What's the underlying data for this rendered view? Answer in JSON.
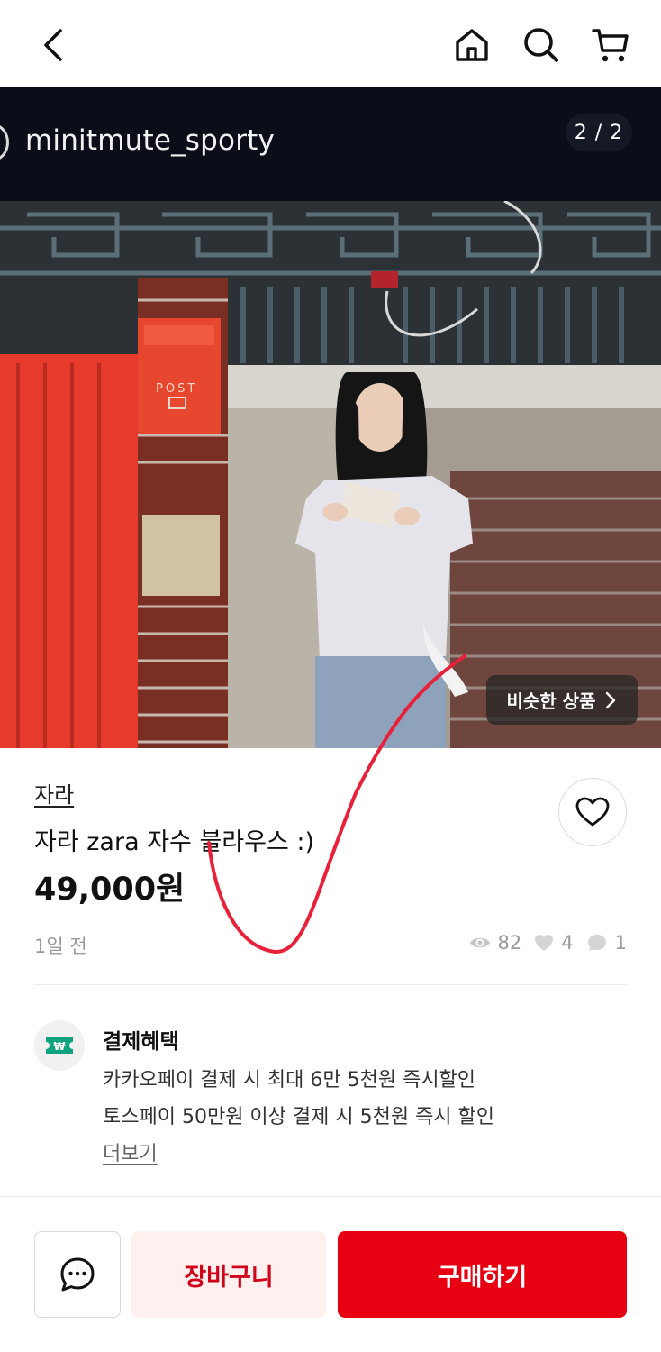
{
  "seller": {
    "name": "minitmute_sporty",
    "photo_counter": "2 / 2"
  },
  "photo": {
    "similar_label": "비슷한 상품",
    "mailbox_text": "POST"
  },
  "product": {
    "brand": "자라",
    "title": "자라 zara 자수 블라우스 :)",
    "price": "49,000원",
    "posted": "1일 전",
    "views": "82",
    "likes": "4",
    "comments": "1"
  },
  "benefits": {
    "icon_text": "₩",
    "title": "결제혜택",
    "lines": [
      "카카오페이 결제 시 최대 6만 5천원 즉시할인",
      "토스페이 50만원 이상 결제 시 5천원 즉시 할인"
    ],
    "more": "더보기"
  },
  "actions": {
    "cart": "장바구니",
    "buy": "구매하기"
  },
  "colors": {
    "accent": "#e60012",
    "dark_header": "#0b0e18",
    "cart_bg": "#fdf0ee",
    "benefit_green": "#11a37f"
  }
}
